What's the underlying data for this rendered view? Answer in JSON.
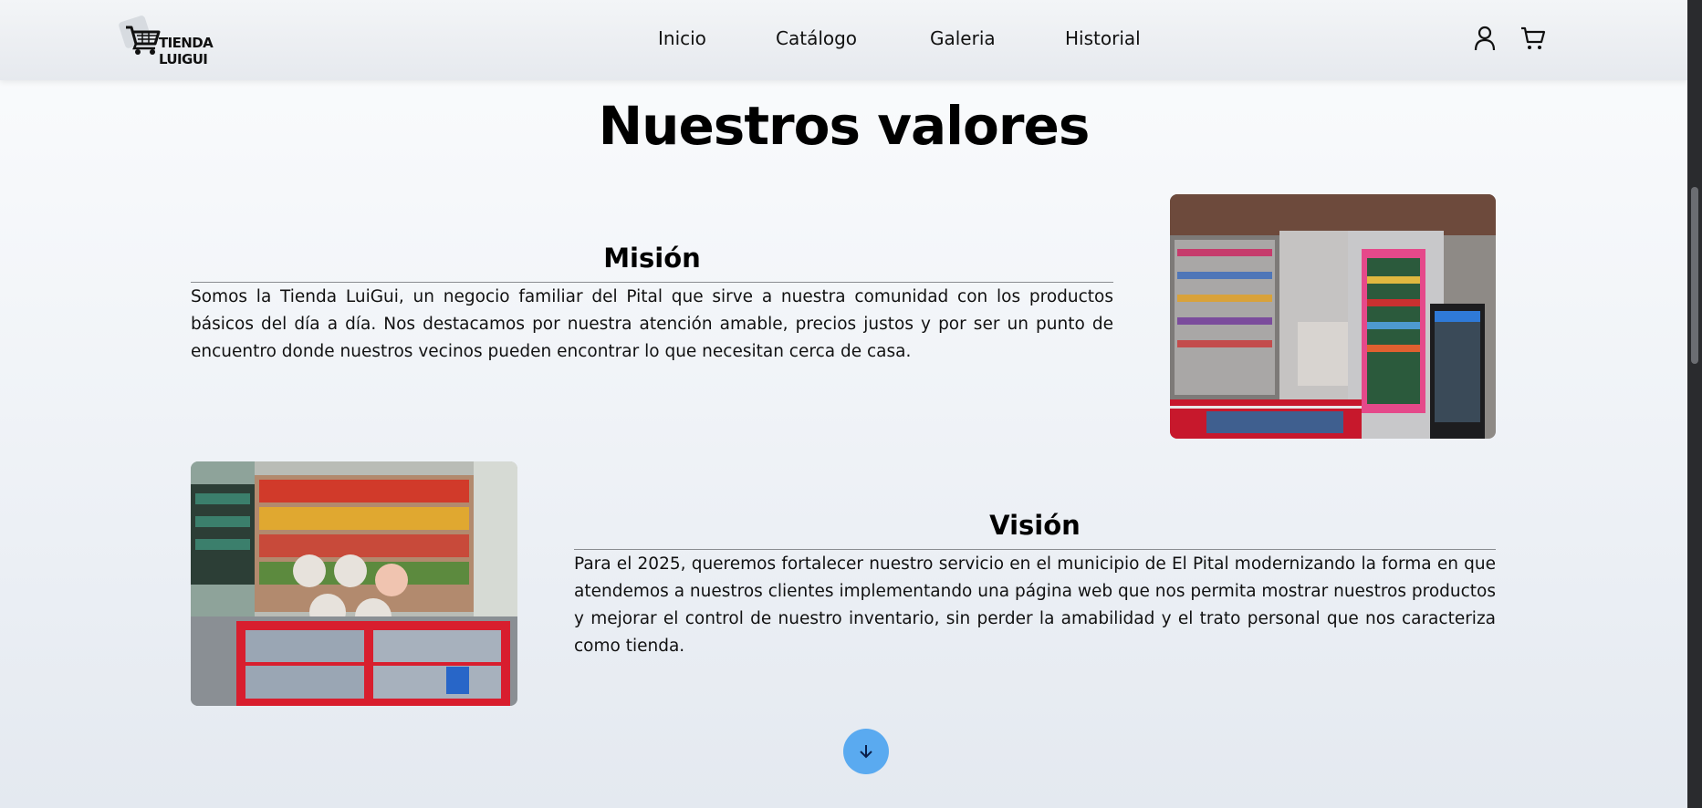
{
  "header": {
    "logo_text": "TIENDA LUIGUI",
    "nav": [
      "Inicio",
      "Catálogo",
      "Galeria",
      "Historial"
    ],
    "icons": {
      "account": "user-icon",
      "cart": "cart-icon"
    }
  },
  "main": {
    "title": "Nuestros valores",
    "mision": {
      "title": "Misión",
      "text": "Somos la Tienda LuiGui, un negocio familiar del Pital que sirve a nuestra comunidad con los productos básicos del día a día. Nos destacamos por nuestra atención amable, precios justos y por ser un punto de encuentro donde nuestros vecinos pueden encontrar lo que necesitan cerca de casa."
    },
    "vision": {
      "title": "Visión",
      "text": "Para el 2025, queremos fortalecer nuestro servicio en el municipio de El Pital modernizando la forma en que atendemos a nuestros clientes implementando una página web que nos permita mostrar nuestros productos y mejorar el control de nuestro inventario, sin perder la amabilidad y el trato personal que nos caracteriza como tienda."
    },
    "scroll_icon": "arrow-down-icon"
  },
  "colors": {
    "accent": "#5aaaf0",
    "header_bg": "#e9ecf0"
  }
}
